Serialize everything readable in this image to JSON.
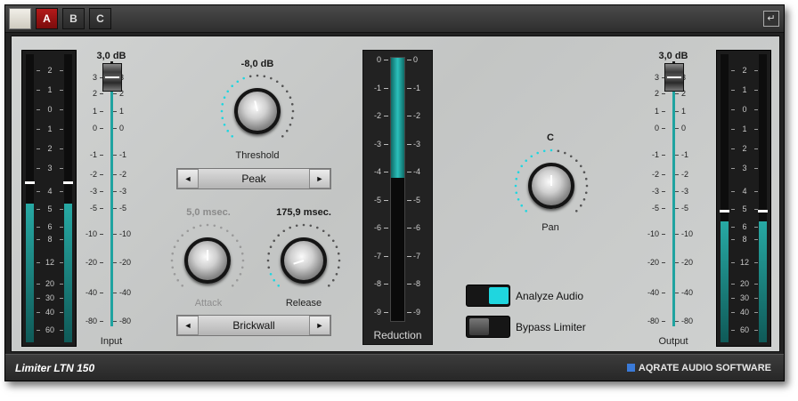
{
  "tabs": [
    {
      "label": "A",
      "active": true
    },
    {
      "label": "B",
      "active": false
    },
    {
      "label": "C",
      "active": false
    }
  ],
  "icons": {
    "undo": "undo-arrow-icon",
    "swatch": "color-swatch-icon"
  },
  "input": {
    "value": "3,0 dB",
    "label": "Input",
    "fader_level_db": 3
  },
  "output": {
    "value": "3,0 dB",
    "label": "Output",
    "fader_level_db": 3
  },
  "fader_scale_left": [
    "3",
    "2",
    "1",
    "0",
    "-1",
    "-2",
    "-3",
    "-5",
    "-10",
    "-20",
    "-40",
    "-80"
  ],
  "fader_scale_right": [
    "3",
    "2",
    "1",
    "0",
    "-1",
    "-2",
    "-3",
    "-5",
    "-10",
    "-20",
    "-40",
    "-80"
  ],
  "meter_scale": [
    "2",
    "1",
    "0",
    "1",
    "2",
    "3",
    "4",
    "5",
    "6",
    "8",
    "12",
    "20",
    "30",
    "40",
    "60"
  ],
  "meter_in": {
    "level_fraction": 0.48,
    "peak_fraction": 0.55
  },
  "meter_out": {
    "level_fraction": 0.42,
    "peak_fraction": 0.45
  },
  "threshold": {
    "value": "-8,0 dB",
    "label": "Threshold",
    "knob_fraction": 0.45
  },
  "attack": {
    "value": "5,0 msec.",
    "label": "Attack",
    "knob_fraction": 0.5,
    "disabled": true
  },
  "release": {
    "value": "175,9 msec.",
    "label": "Release",
    "knob_fraction": 0.1
  },
  "pan": {
    "value": "C",
    "label": "Pan",
    "knob_fraction": 0.5
  },
  "mode_select": {
    "value": "Peak",
    "left_arrow": "◄",
    "right_arrow": "►"
  },
  "type_select": {
    "value": "Brickwall",
    "left_arrow": "◄",
    "right_arrow": "►"
  },
  "reduction": {
    "label": "Reduction",
    "scale": [
      "0",
      "-1",
      "-2",
      "-3",
      "-4",
      "-5",
      "-6",
      "-7",
      "-8",
      "-9"
    ],
    "fill_db": 4.3
  },
  "analyze": {
    "label": "Analyze Audio",
    "on": true
  },
  "bypass": {
    "label": "Bypass Limiter",
    "on": false
  },
  "footer": {
    "product": "Limiter LTN 150",
    "brand": "AQRATE AUDIO SOFTWARE"
  },
  "colors": {
    "accent": "#1fd6df",
    "meter_fill": "#27a9a4",
    "tab_active": "#a01414"
  }
}
